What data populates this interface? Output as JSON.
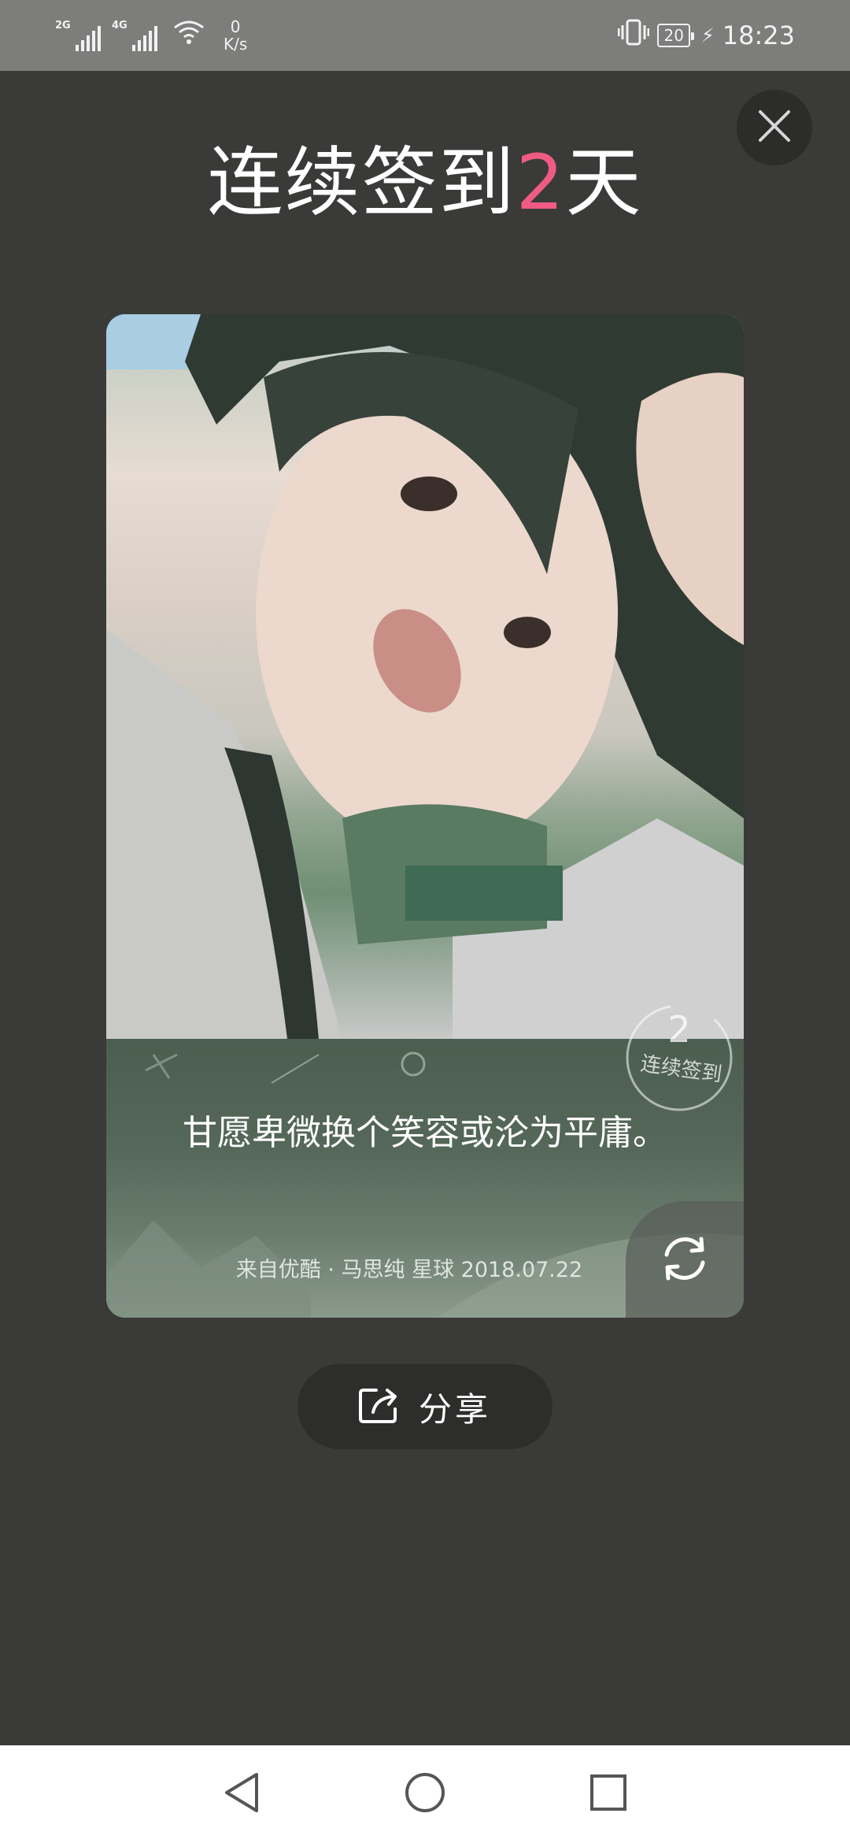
{
  "status_bar": {
    "signal1_tag": "2G",
    "signal2_tag": "4G",
    "net_speed_value": "0",
    "net_speed_unit": "K/s",
    "battery": "20",
    "time": "18:23"
  },
  "header": {
    "title_prefix": "连续签到",
    "title_days": "2",
    "title_suffix": "天"
  },
  "card": {
    "quote": "甘愿卑微换个笑容或沦为平庸。",
    "source": "来自优酷 · 马思纯 星球 2018.07.22",
    "stamp_days": "2",
    "stamp_label": "连续签到"
  },
  "actions": {
    "share_label": "分享"
  },
  "icons": {
    "close": "close-icon",
    "refresh": "refresh-icon",
    "share": "share-icon",
    "nav_back": "back-triangle-icon",
    "nav_home": "home-circle-icon",
    "nav_recent": "recent-square-icon"
  },
  "colors": {
    "background": "#3a3b39",
    "accent_days": "#ef5b83",
    "status_bar": "#7d7e7c"
  }
}
